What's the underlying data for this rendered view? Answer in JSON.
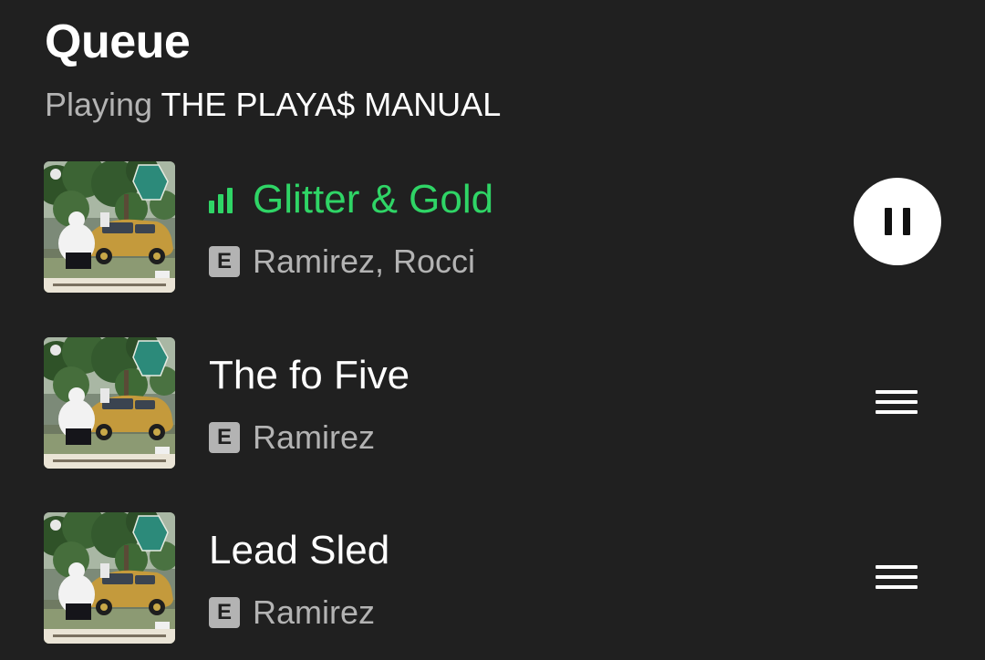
{
  "queue": {
    "title": "Queue",
    "context_label": "Playing",
    "context_name": "THE PLAYA$ MANUAL"
  },
  "tracks": [
    {
      "title": "Glitter & Gold",
      "explicit_badge": "E",
      "artists": "Ramirez, Rocci",
      "state": "playing",
      "action_icon": "pause-icon"
    },
    {
      "title": "The fo Five",
      "explicit_badge": "E",
      "artists": "Ramirez",
      "state": "queued",
      "action_icon": "drag-handle-icon"
    },
    {
      "title": "Lead Sled",
      "explicit_badge": "E",
      "artists": "Ramirez",
      "state": "queued",
      "action_icon": "drag-handle-icon"
    }
  ],
  "colors": {
    "background": "#202020",
    "accent_playing": "#2fd566",
    "secondary_text": "#b3b3b3",
    "primary_text": "#ffffff"
  }
}
